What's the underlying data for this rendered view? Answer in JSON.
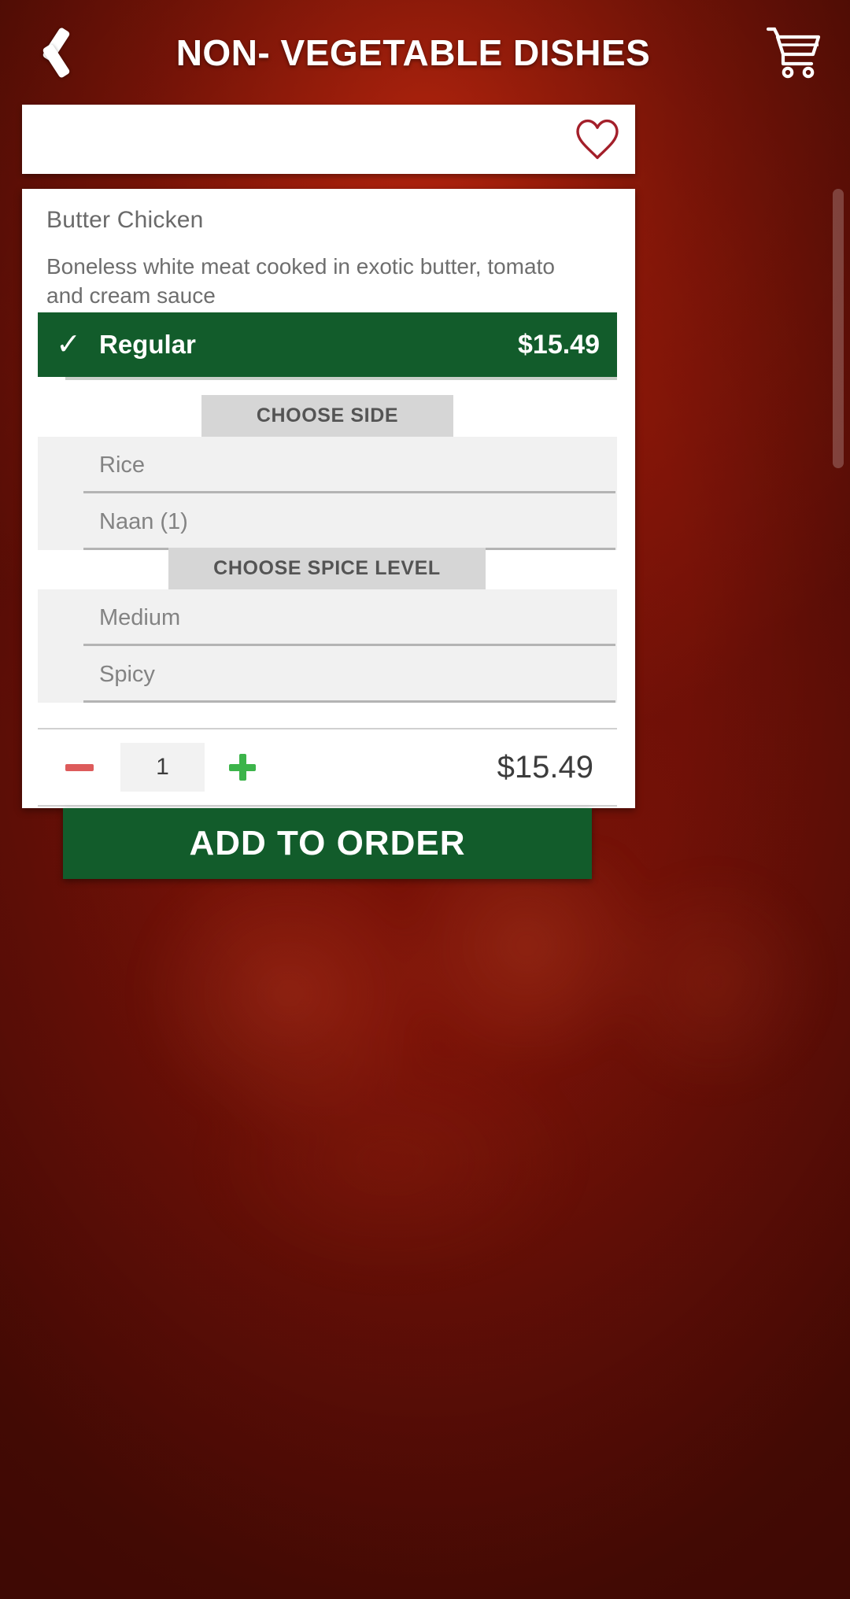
{
  "header": {
    "title": "NON- VEGETABLE DISHES",
    "back_icon": "chevron-left-icon",
    "cart_icon": "shopping-cart-icon"
  },
  "favorite_bar": {
    "heart_icon": "heart-outline-icon"
  },
  "item": {
    "name": "Butter Chicken",
    "description": "Boneless white meat cooked in exotic butter, tomato and cream sauce",
    "variant": {
      "label": "Regular",
      "price": "$15.49",
      "selected": true,
      "check_icon": "check-icon"
    },
    "option_groups": [
      {
        "header": "CHOOSE SIDE",
        "options": [
          {
            "label": "Rice"
          },
          {
            "label": "Naan (1)"
          }
        ]
      },
      {
        "header": "CHOOSE SPICE LEVEL",
        "options": [
          {
            "label": "Medium"
          },
          {
            "label": "Spicy"
          }
        ]
      }
    ],
    "quantity": {
      "value": "1",
      "minus_icon": "minus-icon",
      "plus_icon": "plus-icon",
      "total": "$15.49"
    }
  },
  "actions": {
    "add_to_order": "ADD TO ORDER"
  },
  "colors": {
    "brand_red": "#b22410",
    "accent_green": "#125c2b",
    "minus_red": "#dd5b5b",
    "plus_green": "#3cb44a",
    "heart_red": "#a31f2a"
  }
}
